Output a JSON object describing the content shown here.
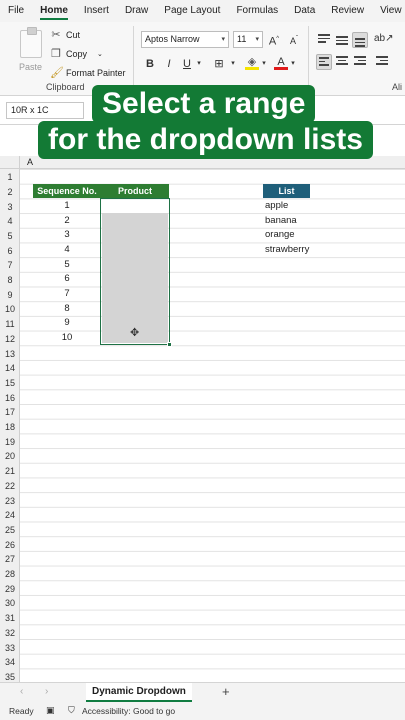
{
  "ribbon_tabs": [
    "File",
    "Home",
    "Insert",
    "Draw",
    "Page Layout",
    "Formulas",
    "Data",
    "Review",
    "View"
  ],
  "ribbon_active_tab": "Home",
  "clipboard": {
    "paste_label": "Paste",
    "cut_label": "Cut",
    "copy_label": "Copy",
    "format_painter_label": "Format Painter",
    "group_label": "Clipboard"
  },
  "font": {
    "family": "Aptos Narrow",
    "size": "11",
    "grow_label": "A",
    "shrink_label": "A",
    "bold_label": "B",
    "italic_label": "I",
    "underline_label": "U"
  },
  "alignment_group_label_partial": "Ali",
  "name_box": "10R x 1C",
  "banner": {
    "line1": "Select a range",
    "line2": "for the dropdown lists"
  },
  "column_a_header": "A",
  "row_numbers": [
    "1",
    "2",
    "3",
    "4",
    "5",
    "6",
    "7",
    "8",
    "9",
    "10",
    "11",
    "12",
    "13",
    "14",
    "15",
    "16",
    "17",
    "18",
    "19",
    "20",
    "21",
    "22",
    "23",
    "24",
    "25",
    "26",
    "27",
    "28",
    "29",
    "30",
    "31",
    "32",
    "33",
    "34",
    "35"
  ],
  "table": {
    "header_sequence": "Sequence No.",
    "header_product": "Product",
    "sequence_values": [
      "1",
      "2",
      "3",
      "4",
      "5",
      "6",
      "7",
      "8",
      "9",
      "10"
    ]
  },
  "list": {
    "header": "List",
    "items": [
      "apple",
      "banana",
      "orange",
      "strawberry"
    ]
  },
  "sheet_tab": "Dynamic Dropdown",
  "status": {
    "ready": "Ready",
    "accessibility": "Accessibility: Good to go"
  },
  "colors": {
    "excel_green": "#107c41",
    "table_header_green": "#2e7d32",
    "list_header_blue": "#1f5f7a",
    "banner_green": "#137a35"
  }
}
